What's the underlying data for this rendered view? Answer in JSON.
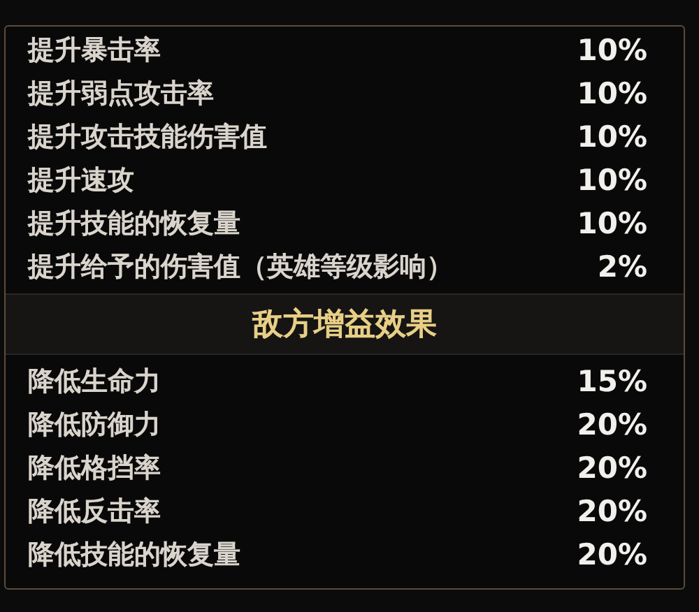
{
  "buff_rows": [
    {
      "label": "提升暴击率",
      "value": "10%"
    },
    {
      "label": "提升弱点攻击率",
      "value": "10%"
    },
    {
      "label": "提升攻击技能伤害值",
      "value": "10%"
    },
    {
      "label": "提升速攻",
      "value": "10%"
    },
    {
      "label": "提升技能的恢复量",
      "value": "10%"
    },
    {
      "label": "提升给予的伤害值（英雄等级影响）",
      "value": "2%"
    }
  ],
  "enemy_section": {
    "title": "敌方增益效果",
    "rows": [
      {
        "label": "降低生命力",
        "value": "15%"
      },
      {
        "label": "降低防御力",
        "value": "20%"
      },
      {
        "label": "降低格挡率",
        "value": "20%"
      },
      {
        "label": "降低反击率",
        "value": "20%"
      },
      {
        "label": "降低技能的恢复量",
        "value": "20%"
      }
    ]
  }
}
